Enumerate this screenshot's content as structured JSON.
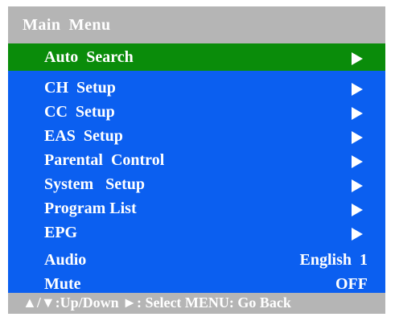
{
  "title": {
    "word1": "Main",
    "word2": "Menu"
  },
  "colors": {
    "title_bar": "#b5b5b5",
    "highlight": "#0a8c0a",
    "list_bg": "#0b5ff0",
    "text": "#ffffff"
  },
  "items": [
    {
      "label": "Auto  Search",
      "indicator": "right-arrow-icon"
    },
    {
      "label": "CH  Setup",
      "indicator": "right-arrow-icon"
    },
    {
      "label": "CC  Setup",
      "indicator": "right-arrow-icon"
    },
    {
      "label": "EAS  Setup",
      "indicator": "right-arrow-icon"
    },
    {
      "label": "Parental  Control",
      "indicator": "right-arrow-icon"
    },
    {
      "label": "System   Setup",
      "indicator": "right-arrow-icon"
    },
    {
      "label": "Program List",
      "indicator": "right-arrow-icon"
    },
    {
      "label": "EPG",
      "indicator": "right-arrow-icon"
    },
    {
      "label": "Audio",
      "value": "English  1"
    },
    {
      "label": "Mute",
      "value": "OFF"
    }
  ],
  "selected_index": 0,
  "footer": {
    "hint": "▲/▼:Up/Down ►: Select MENU: Go Back"
  }
}
